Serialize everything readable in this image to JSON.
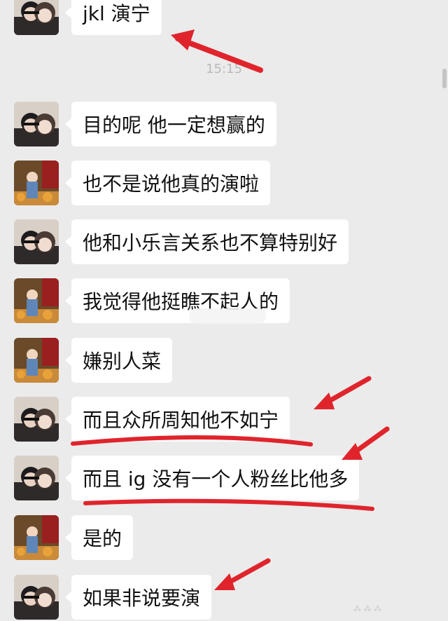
{
  "timestamp": "15:15",
  "messages": [
    {
      "text": "jkl 演宁",
      "avatar": "couple"
    },
    {
      "text": "目的呢 他一定想赢的",
      "avatar": "couple"
    },
    {
      "text": "也不是说他真的演啦",
      "avatar": "girl"
    },
    {
      "text": "他和小乐言关系也不算特别好",
      "avatar": "couple"
    },
    {
      "text": "我觉得他挺瞧不起人的",
      "avatar": "girl"
    },
    {
      "text": "嫌别人菜",
      "avatar": "girl"
    },
    {
      "text": "而且众所周知他不如宁",
      "avatar": "couple"
    },
    {
      "text": "而且 ig 没有一个人粉丝比他多",
      "avatar": "couple"
    },
    {
      "text": "是的",
      "avatar": "girl"
    },
    {
      "text": "如果非说要演",
      "avatar": "couple"
    }
  ],
  "colors": {
    "background": "#ebebeb",
    "bubble": "#ffffff",
    "annotation": "#e0242c"
  },
  "annotation_icons": [
    "arrow-icon",
    "underline-mark"
  ]
}
